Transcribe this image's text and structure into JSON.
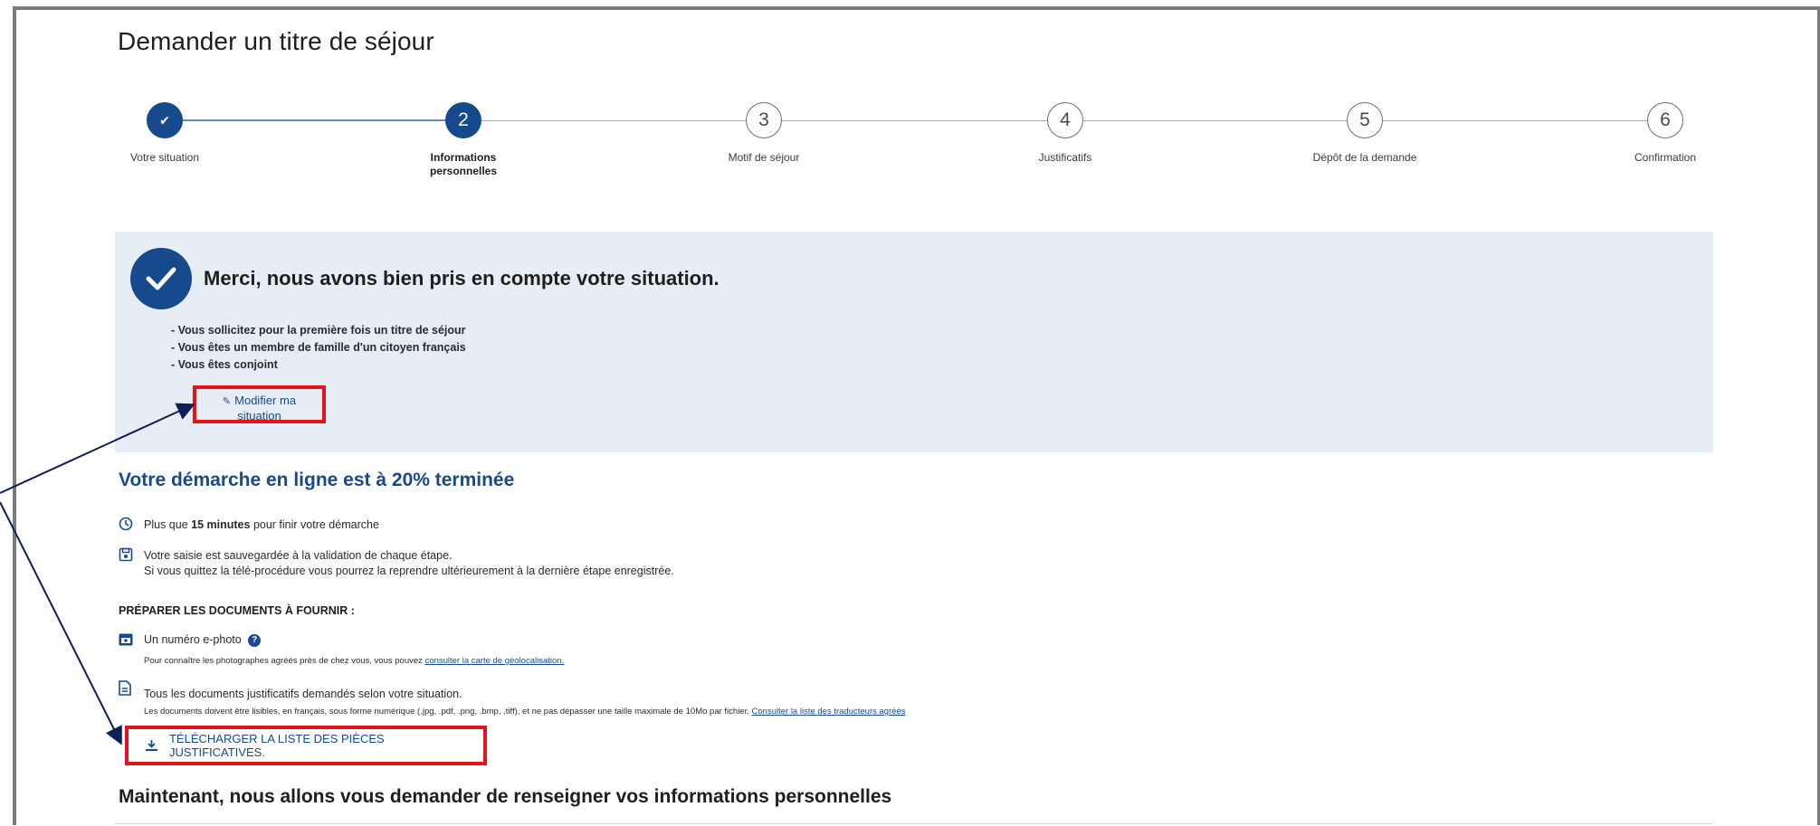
{
  "page": {
    "title": "Demander un titre de séjour"
  },
  "stepper": {
    "steps": [
      {
        "label": "Votre situation",
        "number": "✔",
        "state": "done"
      },
      {
        "label": "Informations personnelles",
        "number": "2",
        "state": "current"
      },
      {
        "label": "Motif de séjour",
        "number": "3",
        "state": "todo"
      },
      {
        "label": "Justificatifs",
        "number": "4",
        "state": "todo"
      },
      {
        "label": "Dépôt de la demande",
        "number": "5",
        "state": "todo"
      },
      {
        "label": "Confirmation",
        "number": "6",
        "state": "todo"
      }
    ]
  },
  "confirmation": {
    "title": "Merci, nous avons bien pris en compte votre situation.",
    "situation": [
      "- Vous sollicitez pour la première fois un titre de séjour",
      "- Vous êtes un membre de famille d'un citoyen français",
      "- Vous êtes conjoint"
    ],
    "modify_label_line1": "Modifier ma",
    "modify_label_line2": "situation"
  },
  "progress": {
    "title": "Votre démarche en ligne est à 20% terminée",
    "percent": 20,
    "time_prefix": "Plus que",
    "time_value": "15 minutes",
    "time_suffix": "pour finir votre démarche",
    "save_line1": "Votre saisie est sauvegardée à la validation de chaque étape.",
    "save_line2": "Si vous quittez la télé-procédure vous pourrez la reprendre ultérieurement à la dernière étape enregistrée."
  },
  "documents": {
    "title": "PRÉPARER LES DOCUMENTS À FOURNIR :",
    "ephoto_label": "Un numéro e-photo",
    "ephoto_note": "Pour connaître les photographes agréés près de chez vous, vous pouvez",
    "ephoto_link": "consulter la carte de géolocalisation.",
    "justif_label": "Tous les documents justificatifs demandés selon votre situation.",
    "justif_note": "Les documents doivent être lisibles, en français, sous forme numérique (.jpg, .pdf, .png, .bmp, .tiff), et ne pas dépasser une taille maximale de 10Mo par fichier.",
    "justif_link": "Consulter la liste des traducteurs agréés",
    "download_label": "TÉLÉCHARGER LA LISTE DES PIÈCES JUSTIFICATIVES."
  },
  "next": {
    "title": "Maintenant, nous allons vous demander de renseigner vos informations personnelles"
  },
  "colors": {
    "primary": "#174a8d",
    "panel": "#e7edf5",
    "highlight": "#e2141b"
  }
}
